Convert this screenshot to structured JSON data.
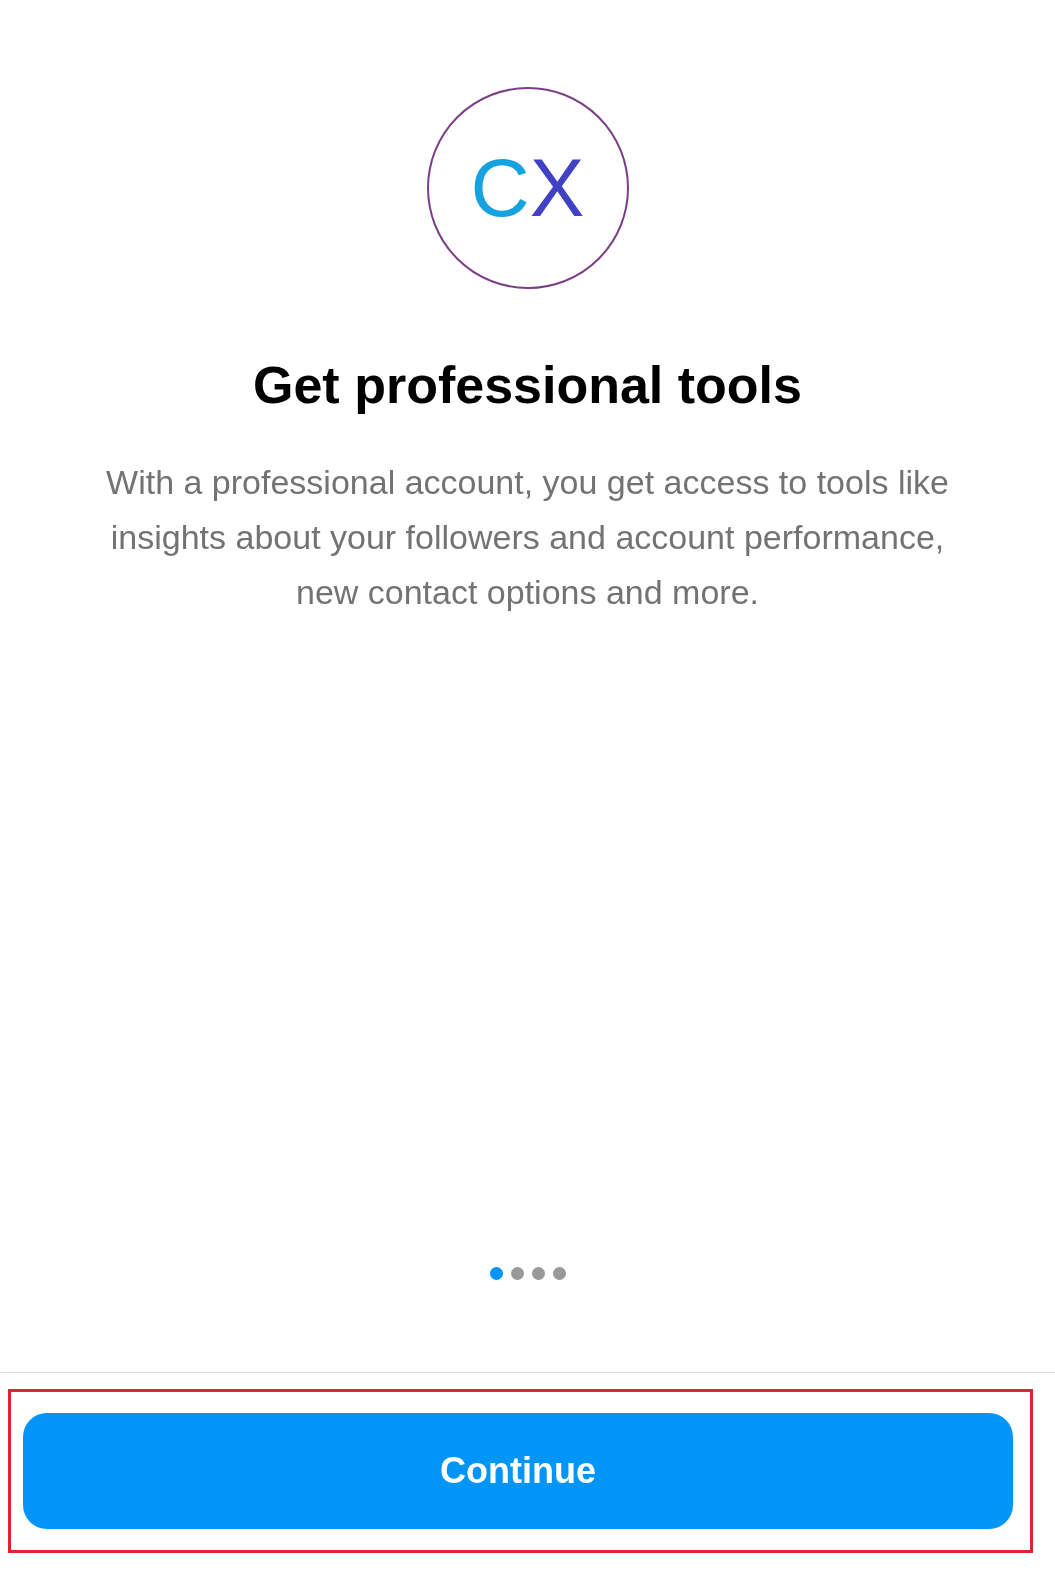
{
  "logo": {
    "text": "CX"
  },
  "title": "Get professional tools",
  "description": "With a professional account, you get access to tools like insights about your followers and account performance, new contact options and more.",
  "pager": [
    {
      "selected": true
    },
    {
      "selected": false
    },
    {
      "selected": false
    },
    {
      "selected": false
    }
  ],
  "continue_button": {
    "label": "Continue",
    "highlighted": true
  }
}
